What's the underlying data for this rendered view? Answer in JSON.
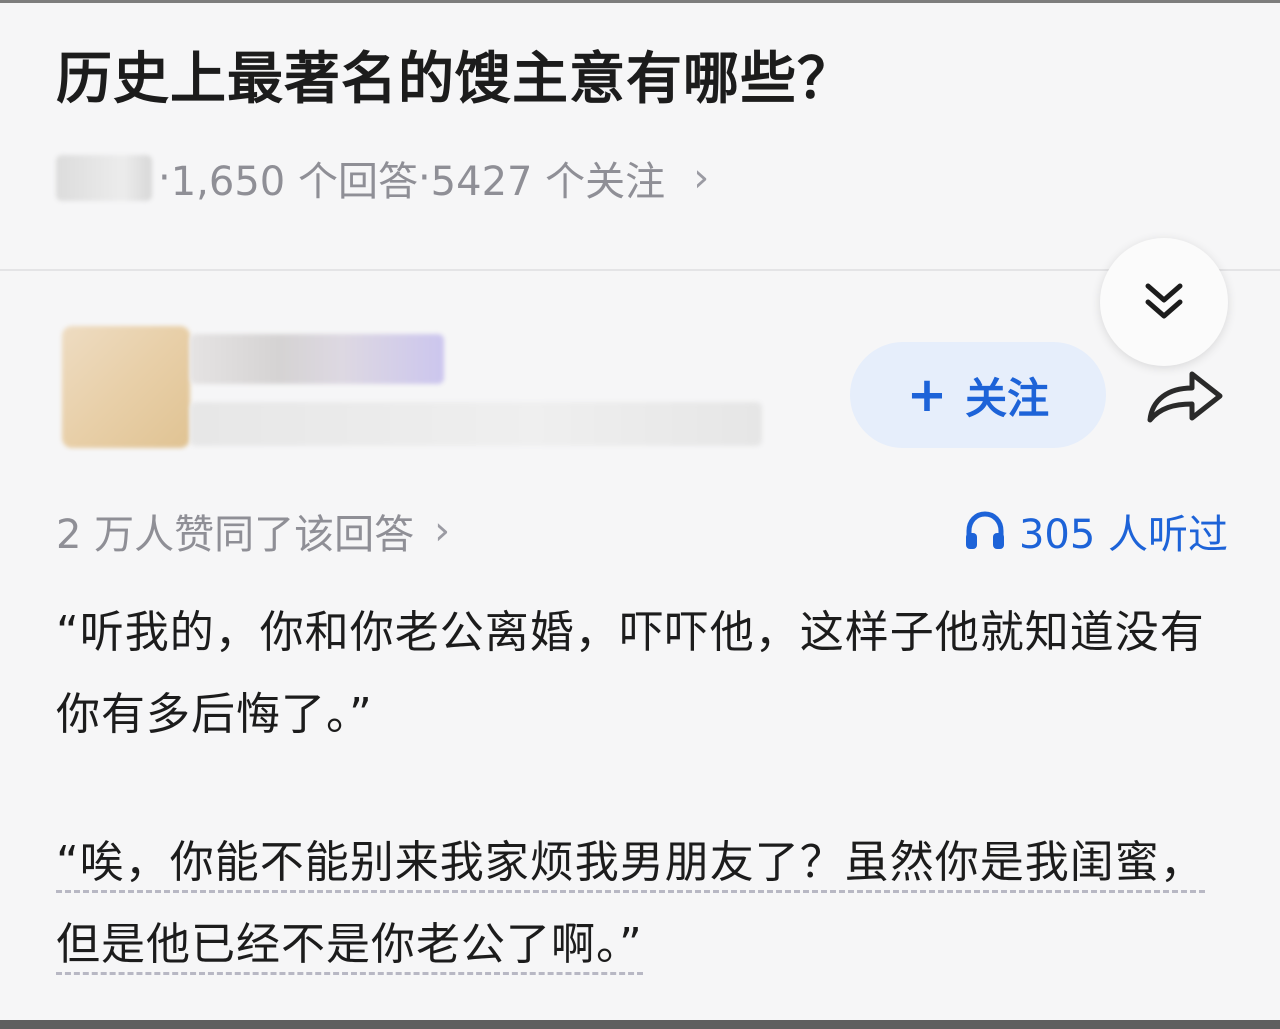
{
  "question": {
    "title": "历史上最著名的馊主意有哪些？",
    "answers_count": "1,650 个回答",
    "followers_count": "5427 个关注",
    "separator": "·",
    "chevron": "›"
  },
  "author": {
    "follow_label": "关注",
    "follow_prefix": "+"
  },
  "answer": {
    "upvote_text": "2 万人赞同了该回答",
    "upvote_chevron": "›",
    "listen_count": "305 人听过",
    "paragraphs": [
      "“听我的，你和你老公离婚，吓吓他，这样子他就知道没有你有多后悔了。”",
      "“唉，你能不能别来我家烦我男朋友了？虽然你是我闺蜜，但是他已经不是你老公了啊。”"
    ]
  },
  "icons": {
    "collapse": "double-chevron-down-icon",
    "share": "share-arrow-icon",
    "listen": "headphones-icon"
  },
  "colors": {
    "accent": "#1d63d8",
    "follow_bg": "#e6eefb",
    "meta_text": "#8f8f96"
  }
}
